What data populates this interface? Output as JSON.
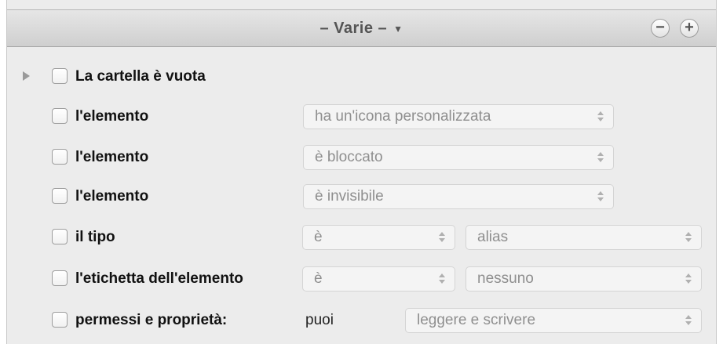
{
  "header": {
    "title": "– Varie –",
    "remove_label": "−",
    "add_label": "+"
  },
  "rows": [
    {
      "label": "La cartella è vuota"
    },
    {
      "label": "l'elemento",
      "select1": "ha un'icona personalizzata"
    },
    {
      "label": "l'elemento",
      "select1": "è bloccato"
    },
    {
      "label": "l'elemento",
      "select1": "è invisibile"
    },
    {
      "label": "il tipo",
      "select1": "è",
      "select2": "alias"
    },
    {
      "label": "l'etichetta dell'elemento",
      "select1": "è",
      "select2": "nessuno"
    },
    {
      "label": "permessi e proprietà:",
      "text": "puoi",
      "select1": "leggere e scrivere"
    }
  ]
}
